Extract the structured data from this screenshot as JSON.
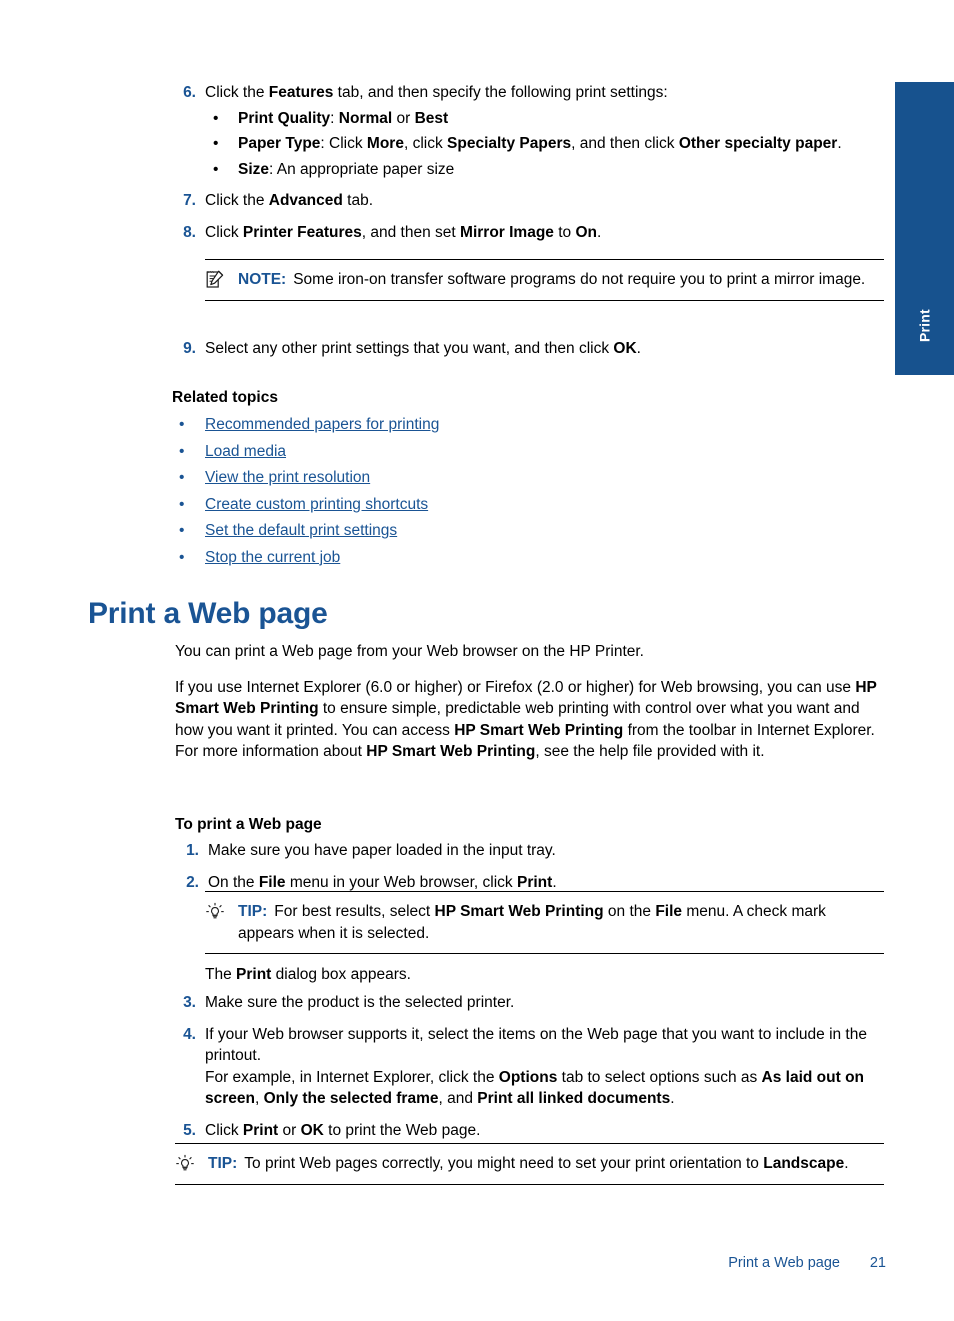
{
  "side_tab": {
    "label": "Print",
    "color": "#17528e"
  },
  "colors": {
    "accent_blue": "#1a5494",
    "tab_blue": "#17528e"
  },
  "iron_on_steps": [
    {
      "num": "6.",
      "segments": [
        {
          "t": "Click the ",
          "b": false
        },
        {
          "t": "Features",
          "b": true
        },
        {
          "t": " tab, and then specify the following print settings:",
          "b": false
        }
      ],
      "bullets": [
        [
          {
            "t": "Print Quality",
            "b": true
          },
          {
            "t": ": ",
            "b": false
          },
          {
            "t": "Normal",
            "b": true
          },
          {
            "t": " or ",
            "b": false
          },
          {
            "t": "Best",
            "b": true
          }
        ],
        [
          {
            "t": "Paper Type",
            "b": true
          },
          {
            "t": ": Click ",
            "b": false
          },
          {
            "t": "More",
            "b": true
          },
          {
            "t": ", click ",
            "b": false
          },
          {
            "t": "Specialty Papers",
            "b": true
          },
          {
            "t": ", and then click ",
            "b": false
          },
          {
            "t": "Other specialty paper",
            "b": true
          },
          {
            "t": ".",
            "b": false
          }
        ],
        [
          {
            "t": "Size",
            "b": true
          },
          {
            "t": ": An appropriate paper size",
            "b": false
          }
        ]
      ]
    },
    {
      "num": "7.",
      "segments": [
        {
          "t": "Click the ",
          "b": false
        },
        {
          "t": "Advanced",
          "b": true
        },
        {
          "t": " tab.",
          "b": false
        }
      ],
      "bullets": []
    },
    {
      "num": "8.",
      "segments": [
        {
          "t": "Click ",
          "b": false
        },
        {
          "t": "Printer Features",
          "b": true
        },
        {
          "t": ", and then set ",
          "b": false
        },
        {
          "t": "Mirror Image",
          "b": true
        },
        {
          "t": " to ",
          "b": false
        },
        {
          "t": "On",
          "b": true
        },
        {
          "t": ".",
          "b": false
        }
      ],
      "bullets": []
    }
  ],
  "note_mirror": {
    "icon": "note-icon",
    "keyword": "NOTE:",
    "segments": [
      {
        "t": "Some iron-on transfer software programs do not require you to print a mirror image.",
        "b": false
      }
    ]
  },
  "step9": {
    "num": "9.",
    "segments": [
      {
        "t": "Select any other print settings that you want, and then click ",
        "b": false
      },
      {
        "t": "OK",
        "b": true
      },
      {
        "t": ".",
        "b": false
      }
    ]
  },
  "related": {
    "heading": "Related topics",
    "links": [
      "Recommended papers for printing",
      "Load media",
      "View the print resolution",
      "Create custom printing shortcuts",
      "Set the default print settings",
      "Stop the current job"
    ]
  },
  "section": {
    "title": "Print a Web page",
    "para1": [
      {
        "t": "You can print a Web page from your Web browser on the HP Printer.",
        "b": false
      }
    ],
    "para2": [
      {
        "t": "If you use Internet Explorer (6.0 or higher) or Firefox (2.0 or higher) for Web browsing, you can use ",
        "b": false
      },
      {
        "t": "HP Smart Web Printing",
        "b": true
      },
      {
        "t": " to ensure simple, predictable web printing with control over what you want and how you want it printed. You can access ",
        "b": false
      },
      {
        "t": "HP Smart Web Printing",
        "b": true
      },
      {
        "t": " from the toolbar in Internet Explorer. For more information about ",
        "b": false
      },
      {
        "t": "HP Smart Web Printing",
        "b": true
      },
      {
        "t": ", see the help file provided with it.",
        "b": false
      }
    ],
    "procedure_heading": "To print a Web page"
  },
  "web_steps_a": [
    {
      "num": "1.",
      "segments": [
        {
          "t": "Make sure you have paper loaded in the input tray.",
          "b": false
        }
      ]
    },
    {
      "num": "2.",
      "segments": [
        {
          "t": "On the ",
          "b": false
        },
        {
          "t": "File",
          "b": true
        },
        {
          "t": " menu in your Web browser, click ",
          "b": false
        },
        {
          "t": "Print",
          "b": true
        },
        {
          "t": ".",
          "b": false
        }
      ]
    }
  ],
  "tip_smart": {
    "icon": "tip-icon",
    "keyword": "TIP:",
    "segments": [
      {
        "t": "For best results, select ",
        "b": false
      },
      {
        "t": "HP Smart Web Printing",
        "b": true
      },
      {
        "t": " on the ",
        "b": false
      },
      {
        "t": "File",
        "b": true
      },
      {
        "t": " menu. A check mark appears when it is selected.",
        "b": false
      }
    ]
  },
  "dialog_line": [
    {
      "t": "The ",
      "b": false
    },
    {
      "t": "Print",
      "b": true
    },
    {
      "t": " dialog box appears.",
      "b": false
    }
  ],
  "web_steps_b": [
    {
      "num": "3.",
      "segments": [
        {
          "t": "Make sure the product is the selected printer.",
          "b": false
        }
      ]
    },
    {
      "num": "4.",
      "segments": [
        {
          "t": "If your Web browser supports it, select the items on the Web page that you want to include in the printout.",
          "b": false
        },
        {
          "t": "\n",
          "b": false
        },
        {
          "t": "For example, in Internet Explorer, click the ",
          "b": false
        },
        {
          "t": "Options",
          "b": true
        },
        {
          "t": " tab to select options such as ",
          "b": false
        },
        {
          "t": "As laid out on screen",
          "b": true
        },
        {
          "t": ", ",
          "b": false
        },
        {
          "t": "Only the selected frame",
          "b": true
        },
        {
          "t": ", and ",
          "b": false
        },
        {
          "t": "Print all linked documents",
          "b": true
        },
        {
          "t": ".",
          "b": false
        }
      ]
    },
    {
      "num": "5.",
      "segments": [
        {
          "t": "Click ",
          "b": false
        },
        {
          "t": "Print",
          "b": true
        },
        {
          "t": " or ",
          "b": false
        },
        {
          "t": "OK",
          "b": true
        },
        {
          "t": " to print the Web page.",
          "b": false
        }
      ]
    }
  ],
  "tip_landscape": {
    "icon": "tip-icon",
    "keyword": "TIP:",
    "segments": [
      {
        "t": "To print Web pages correctly, you might need to set your print orientation to ",
        "b": false
      },
      {
        "t": "Landscape",
        "b": true
      },
      {
        "t": ".",
        "b": false
      }
    ]
  },
  "footer": {
    "title": "Print a Web page",
    "page_number": "21"
  }
}
